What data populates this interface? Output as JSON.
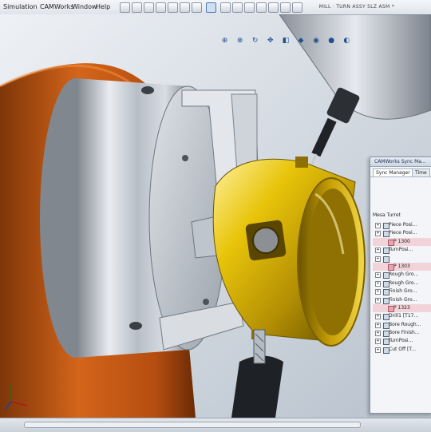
{
  "menu": [
    "Simulation",
    "CAMWorks",
    "Window",
    "Help"
  ],
  "window_title": "MILL · TURN ASSY SLZ ASM *",
  "cam_panel": {
    "title": "CAMWorks Sync Ma...",
    "tabs": [
      "Sync Manager",
      "Time"
    ],
    "root": "Mesa Turret",
    "items": [
      {
        "label": "Piece Posi...",
        "highlight": false,
        "indent": false
      },
      {
        "label": "Piece Posi...",
        "highlight": false,
        "indent": false
      },
      {
        "label": "P 1300",
        "highlight": true,
        "indent": true
      },
      {
        "label": "TurnPosi...",
        "highlight": false,
        "indent": false
      },
      {
        "label": "",
        "highlight": false,
        "indent": false
      },
      {
        "label": "P 1303",
        "highlight": true,
        "indent": true
      },
      {
        "label": "Rough Gro...",
        "highlight": false,
        "indent": false
      },
      {
        "label": "Rough Gro...",
        "highlight": false,
        "indent": false
      },
      {
        "label": "Finish Gro...",
        "highlight": false,
        "indent": false
      },
      {
        "label": "Finish Gro...",
        "highlight": false,
        "indent": false
      },
      {
        "label": "P 1323",
        "highlight": true,
        "indent": true
      },
      {
        "label": "Drill1 [T17...",
        "highlight": false,
        "indent": false
      },
      {
        "label": "Bore Rough...",
        "highlight": false,
        "indent": false
      },
      {
        "label": "Bore Finish...",
        "highlight": false,
        "indent": false
      },
      {
        "label": "TurnPosi...",
        "highlight": false,
        "indent": false
      },
      {
        "label": "Cut Off [T...",
        "highlight": false,
        "indent": false
      }
    ]
  },
  "icons": {
    "view_toolbar": [
      "zoom-fit-icon",
      "zoom-area-icon",
      "rotate-icon",
      "pan-icon",
      "section-view-icon",
      "display-style-icon",
      "hide-show-icon",
      "appearance-icon",
      "scene-icon"
    ]
  },
  "colors": {
    "lathe_orange": "#c85a12",
    "part_gold": "#e7c20b",
    "chuck_silver": "#c9ced6",
    "background": "#c9d2dc",
    "highlight_row": "#f2d3d9"
  }
}
